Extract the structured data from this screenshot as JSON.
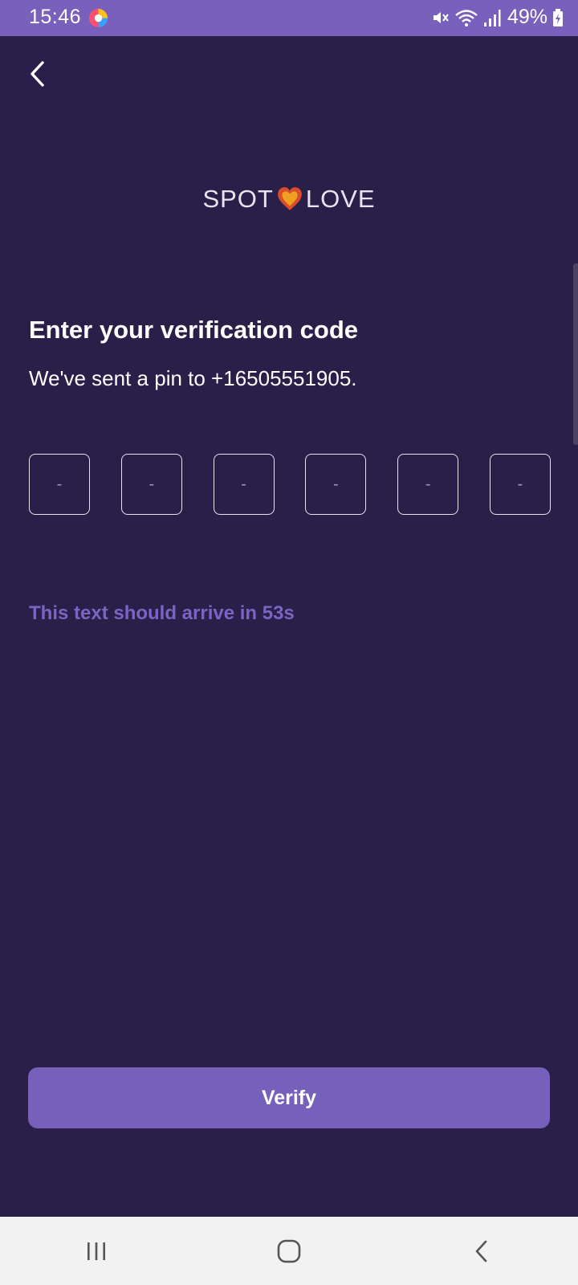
{
  "status_bar": {
    "time": "15:46",
    "battery": "49%",
    "icons": [
      "app-notification-icon",
      "mute-icon",
      "wifi-icon",
      "signal-icon",
      "battery-icon"
    ]
  },
  "header": {
    "back_icon": "chevron-left-icon"
  },
  "logo": {
    "left": "SPOT",
    "right": "LOVE",
    "heart_color": "#d94d2a"
  },
  "content": {
    "title": "Enter your verification code",
    "subtitle": "We've sent a pin to +16505551905.",
    "pin_boxes": [
      "-",
      "-",
      "-",
      "-",
      "-",
      "-"
    ],
    "timer_text": "This text should arrive in 53s"
  },
  "actions": {
    "verify_label": "Verify"
  },
  "nav": {
    "items": [
      "recent-apps-icon",
      "home-icon",
      "back-icon"
    ]
  },
  "colors": {
    "background": "#291f49",
    "accent": "#7560bb",
    "status_bar": "#7a60bd"
  }
}
